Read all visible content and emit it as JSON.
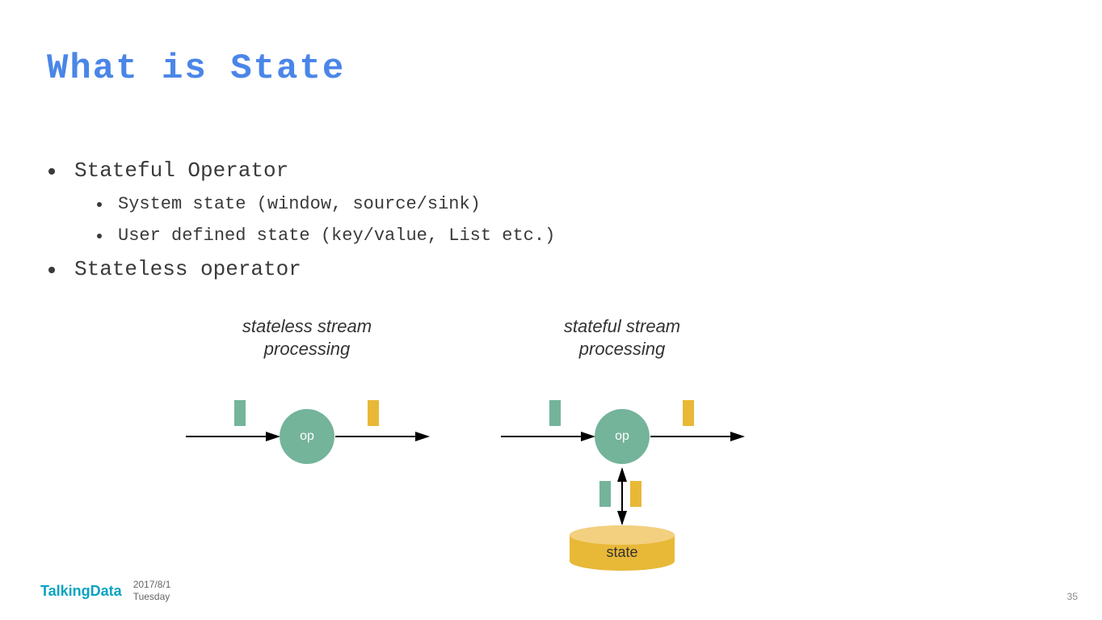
{
  "title": "What is State",
  "bullets": {
    "item1": "Stateful Operator",
    "sub1": "System state (window, source/sink)",
    "sub2": "User defined state (key/value, List etc.)",
    "item2": "Stateless operator"
  },
  "diagram": {
    "left_label_line1": "stateless stream",
    "left_label_line2": "processing",
    "right_label_line1": "stateful stream",
    "right_label_line2": "processing",
    "op_label": "op",
    "state_label": "state"
  },
  "footer": {
    "logo": "TalkingData",
    "date": "2017/8/1",
    "day": "Tuesday"
  },
  "page_number": "35"
}
